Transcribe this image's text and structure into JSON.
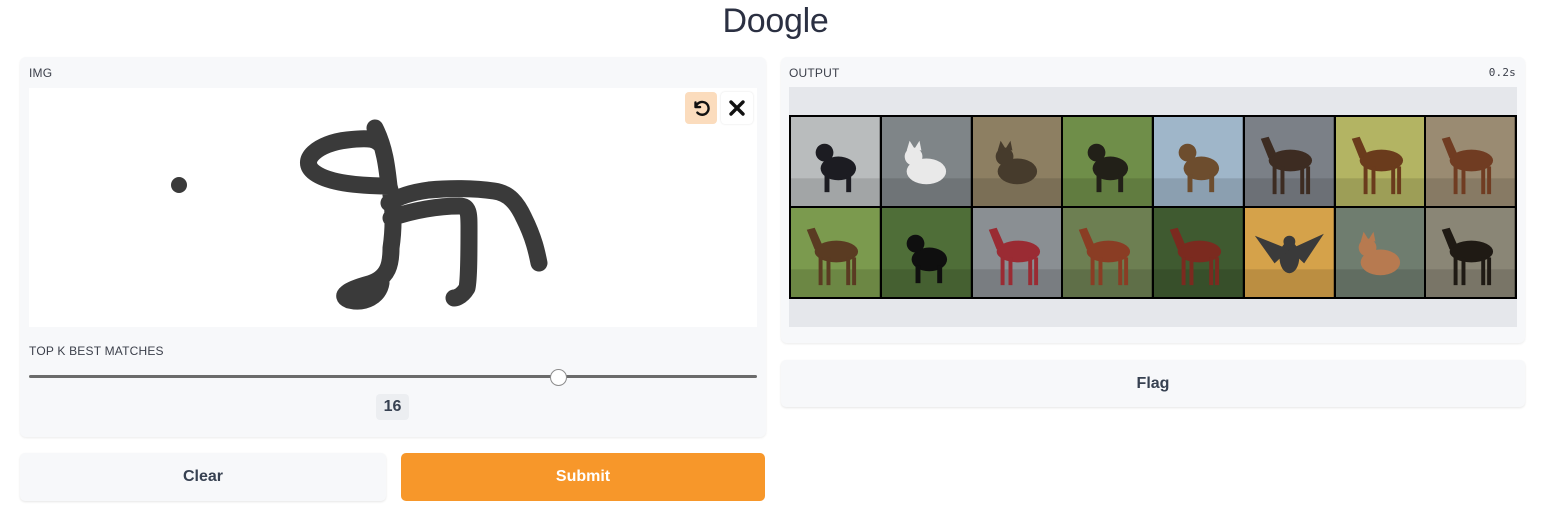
{
  "app": {
    "title": "Doogle"
  },
  "input_panel": {
    "label": "IMG",
    "tools": {
      "undo": "undo-icon",
      "clear": "close-icon"
    }
  },
  "slider": {
    "label": "TOP K BEST MATCHES",
    "value": "16",
    "fraction": 0.728
  },
  "output_panel": {
    "label": "OUTPUT",
    "time": "0.2s"
  },
  "results": [
    {
      "subject": "dog",
      "bg": "#b9bcbd",
      "fg": "#1c1c22"
    },
    {
      "subject": "cat",
      "bg": "#7f8588",
      "fg": "#e9e9e9"
    },
    {
      "subject": "cat",
      "bg": "#8d7f62",
      "fg": "#463b2c"
    },
    {
      "subject": "dog",
      "bg": "#6f8e49",
      "fg": "#222018"
    },
    {
      "subject": "dog",
      "bg": "#9fb6c9",
      "fg": "#6d4d2e"
    },
    {
      "subject": "horse",
      "bg": "#7b8087",
      "fg": "#3d2c22"
    },
    {
      "subject": "horse",
      "bg": "#b3b463",
      "fg": "#6a3b1c"
    },
    {
      "subject": "horse",
      "bg": "#9a8b72",
      "fg": "#703c22"
    },
    {
      "subject": "horse",
      "bg": "#7b9a4e",
      "fg": "#5a3b22"
    },
    {
      "subject": "dog",
      "bg": "#4f6e38",
      "fg": "#0f0f0f"
    },
    {
      "subject": "horse",
      "bg": "#8a8f93",
      "fg": "#9a2b33"
    },
    {
      "subject": "horse",
      "bg": "#6d7f52",
      "fg": "#8a3d24"
    },
    {
      "subject": "horse",
      "bg": "#3f5a30",
      "fg": "#7b2a1f"
    },
    {
      "subject": "bird",
      "bg": "#d5a24a",
      "fg": "#3a3a3a"
    },
    {
      "subject": "cat",
      "bg": "#6f7d6f",
      "fg": "#b77a50"
    },
    {
      "subject": "horse",
      "bg": "#8a8676",
      "fg": "#1f1a14"
    }
  ],
  "buttons": {
    "flag": "Flag",
    "clear": "Clear",
    "submit": "Submit"
  }
}
